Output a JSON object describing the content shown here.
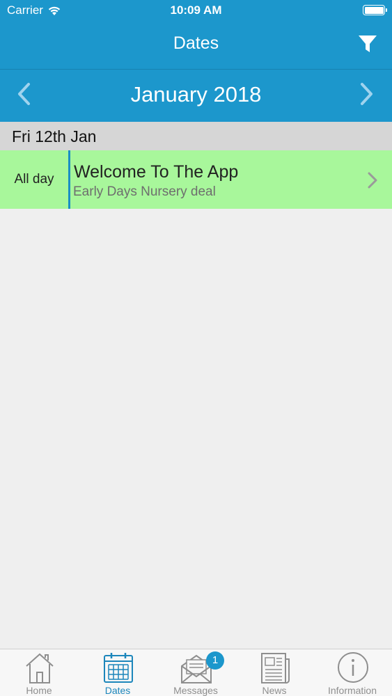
{
  "status_bar": {
    "carrier": "Carrier",
    "time": "10:09 AM"
  },
  "nav": {
    "title": "Dates"
  },
  "calendar": {
    "month": "January 2018"
  },
  "day": {
    "header": "Fri 12th Jan"
  },
  "event": {
    "time": "All day",
    "title": "Welcome To The App",
    "subtitle": "Early Days Nursery deal"
  },
  "tabs": [
    {
      "label": "Home",
      "icon": "house-icon"
    },
    {
      "label": "Dates",
      "icon": "calendar-icon"
    },
    {
      "label": "Messages",
      "icon": "envelope-icon"
    },
    {
      "label": "News",
      "icon": "newspaper-icon"
    },
    {
      "label": "Information",
      "icon": "info-icon"
    }
  ],
  "messages_badge": "1",
  "colors": {
    "primary": "#1c97cc",
    "event_bg": "#a8f79b",
    "active_tab": "#1c86bb",
    "inactive_tab": "#8e8e8e"
  }
}
